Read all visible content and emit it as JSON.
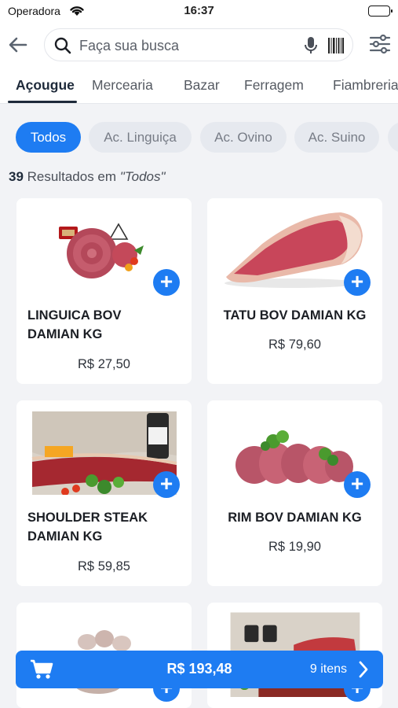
{
  "status": {
    "carrier": "Operadora",
    "time": "16:37"
  },
  "search": {
    "placeholder": "Faça sua busca"
  },
  "tabs": [
    {
      "label": "Açougue",
      "active": true
    },
    {
      "label": "Mercearia"
    },
    {
      "label": "Bazar"
    },
    {
      "label": "Ferragem"
    },
    {
      "label": "Fiambreria"
    }
  ],
  "chips": [
    {
      "label": "Todos",
      "active": true
    },
    {
      "label": "Ac. Linguiça"
    },
    {
      "label": "Ac. Ovino"
    },
    {
      "label": "Ac. Suino"
    }
  ],
  "results": {
    "count": "39",
    "text": "Resultados em",
    "category": "\"Todos\""
  },
  "products": [
    {
      "name_line1": "LINGUICA BOV",
      "name_line2": "DAMIAN KG",
      "price": "R$ 27,50"
    },
    {
      "name_line1": "TATU BOV DAMIAN KG",
      "name_line2": "",
      "price": "R$ 79,60"
    },
    {
      "name_line1": "SHOULDER STEAK",
      "name_line2": "DAMIAN KG",
      "price": "R$ 59,85"
    },
    {
      "name_line1": "RIM BOV DAMIAN KG",
      "name_line2": "",
      "price": "R$ 19,90"
    }
  ],
  "cart": {
    "total": "R$ 193,48",
    "items": "9 itens"
  },
  "colors": {
    "accent": "#1e7cf2",
    "dark": "#1e2a3a"
  }
}
